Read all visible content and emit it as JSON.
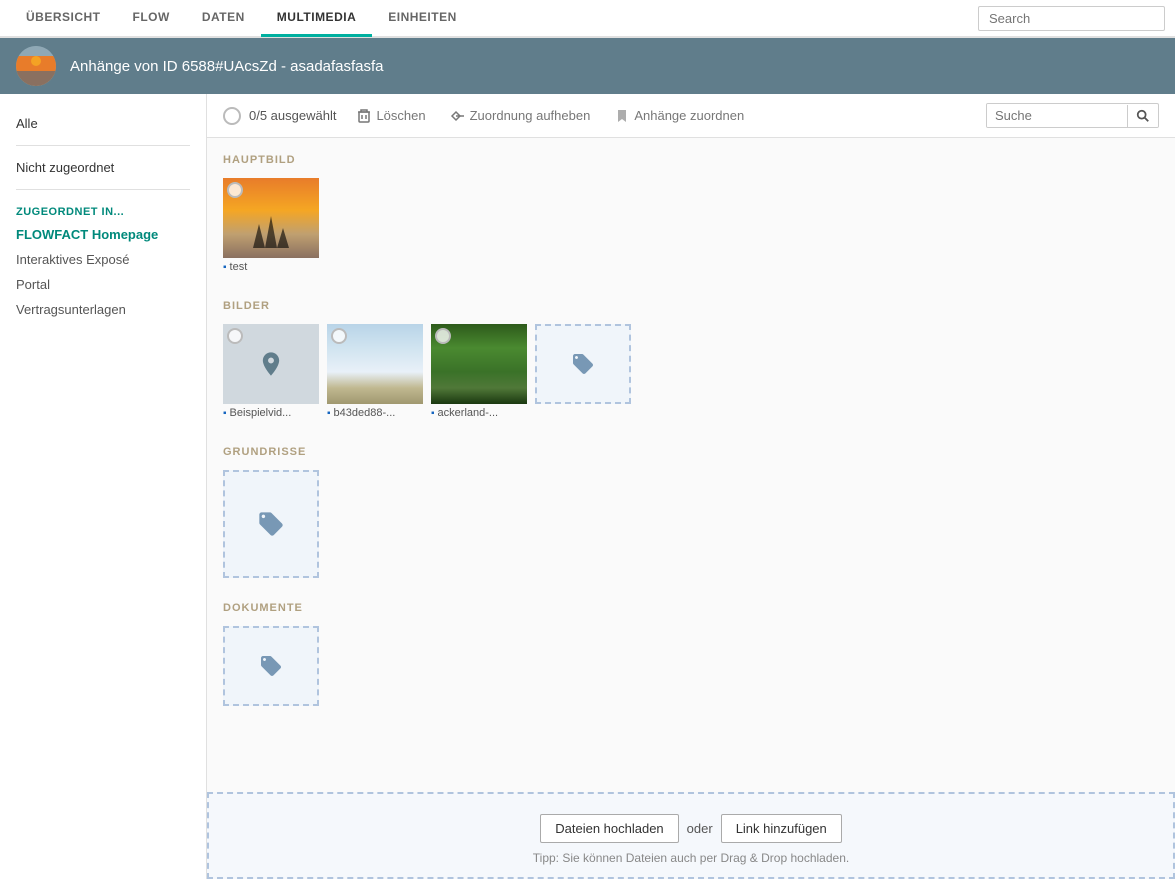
{
  "nav": {
    "items": [
      {
        "id": "ubersicht",
        "label": "ÜBERSICHT",
        "active": false
      },
      {
        "id": "flow",
        "label": "FLOW",
        "active": false
      },
      {
        "id": "daten",
        "label": "DATEN",
        "active": false
      },
      {
        "id": "multimedia",
        "label": "MULTIMEDIA",
        "active": true
      },
      {
        "id": "einheiten",
        "label": "EINHEITEN",
        "active": false
      }
    ],
    "search_placeholder": "Search"
  },
  "header": {
    "title": "Anhänge von ID 6588#UAcsZd - asadafasfasfa"
  },
  "sidebar": {
    "all_label": "Alle",
    "not_assigned_label": "Nicht zugeordnet",
    "section_label": "ZUGEORDNET IN...",
    "links": [
      {
        "id": "flowfact",
        "label": "FLOWFACT Homepage",
        "active": true
      },
      {
        "id": "expose",
        "label": "Interaktives Exposé",
        "active": false
      },
      {
        "id": "portal",
        "label": "Portal",
        "active": false
      },
      {
        "id": "vertragsunterlagen",
        "label": "Vertragsunterlagen",
        "active": false
      }
    ]
  },
  "toolbar": {
    "selection_count": "0/5 ausgewählt",
    "delete_label": "Löschen",
    "unassign_label": "Zuordnung aufheben",
    "assign_label": "Anhänge zuordnen",
    "search_placeholder": "Suche"
  },
  "sections": {
    "hauptbild": {
      "title": "HAUPTBILD",
      "items": [
        {
          "id": "test",
          "label": "test",
          "type": "image"
        }
      ]
    },
    "bilder": {
      "title": "BILDER",
      "items": [
        {
          "id": "beispielvid",
          "label": "Beispielvid...",
          "type": "location"
        },
        {
          "id": "b43ded88",
          "label": "b43ded88-...",
          "type": "pier"
        },
        {
          "id": "ackerland",
          "label": "ackerland-...",
          "type": "forest"
        },
        {
          "id": "dropzone",
          "label": "",
          "type": "dropzone"
        }
      ]
    },
    "grundrisse": {
      "title": "GRUNDRISSE",
      "items": [
        {
          "id": "dropzone",
          "label": "",
          "type": "dropzone"
        }
      ]
    },
    "dokumente": {
      "title": "DOKUMENTE",
      "items": [
        {
          "id": "dropzone2",
          "label": "",
          "type": "dropzone"
        }
      ]
    }
  },
  "upload": {
    "button_label": "Dateien hochladen",
    "or_text": "oder",
    "link_label": "Link hinzufügen",
    "tip": "Tipp: Sie können Dateien auch per Drag & Drop hochladen."
  }
}
